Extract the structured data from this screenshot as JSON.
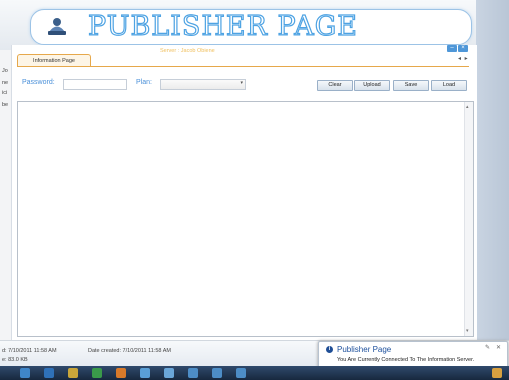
{
  "app": {
    "title": "PUBLISHER PAGE"
  },
  "tabs": [
    {
      "label": "Information Page"
    }
  ],
  "server": {
    "label": "Server : Jacob Obiene"
  },
  "form": {
    "password_label": "Password:",
    "password_value": "",
    "plan_label": "Plan:",
    "plan_value": ""
  },
  "toolbar": {
    "clear": "Clear",
    "upload": "Upload",
    "save": "Save",
    "load": "Load"
  },
  "left_peek": [
    "Jo",
    "ne",
    "ici",
    "be"
  ],
  "status": {
    "modified": "d: 7/10/2011 11:58 AM",
    "created": "Date created: 7/10/2011 11:58 AM",
    "size": "e: 83.0 KB"
  },
  "notification": {
    "title": "Publisher Page",
    "message": "You Are Currently Connected To The Information Server.",
    "icon": "info-icon"
  },
  "colors": {
    "accent_blue": "#4a90d9",
    "tab_border": "#e6a84b",
    "taskbar": "#1e3350"
  }
}
